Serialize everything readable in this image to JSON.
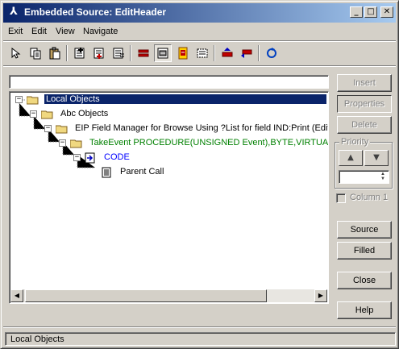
{
  "window": {
    "title": "Embedded Source: EditHeader"
  },
  "title_buttons": {
    "minimize": "_",
    "maximize": "□",
    "close": "✕"
  },
  "menu": {
    "items": [
      "Exit",
      "Edit",
      "View",
      "Navigate"
    ]
  },
  "toolbar": {
    "icons": [
      "cursor-icon",
      "copy-icon",
      "paste-icon",
      "insert-above-icon",
      "insert-below-icon",
      "insert-child-icon",
      "red-bar-icon",
      "embed-icon",
      "source-icon",
      "filled-icon",
      "prev-embed-icon",
      "next-embed-icon",
      "refresh-icon"
    ]
  },
  "tree": {
    "nodes": [
      {
        "label": "Local Objects",
        "expander": "−",
        "selected": true
      },
      {
        "label": "Abc Objects",
        "expander": "−"
      },
      {
        "label": "EIP Field Manager for Browse Using ?List for field IND:Print (EditCl",
        "expander": "−"
      },
      {
        "label": "TakeEvent PROCEDURE(UNSIGNED Event),BYTE,VIRTUAL",
        "expander": "−",
        "color": "green"
      },
      {
        "label": "CODE",
        "expander": "−",
        "color": "blue"
      },
      {
        "label": "Parent Call",
        "expander": ""
      }
    ]
  },
  "buttons": {
    "insert": "Insert",
    "properties": "Properties",
    "delete": "Delete",
    "source": "Source",
    "filled": "Filled",
    "close": "Close",
    "help": "Help"
  },
  "priority": {
    "label": "Priority",
    "up": "▲",
    "down": "▼"
  },
  "column_checkbox": {
    "label": "Column 1",
    "checked": false
  },
  "status": {
    "text": "Local Objects"
  }
}
